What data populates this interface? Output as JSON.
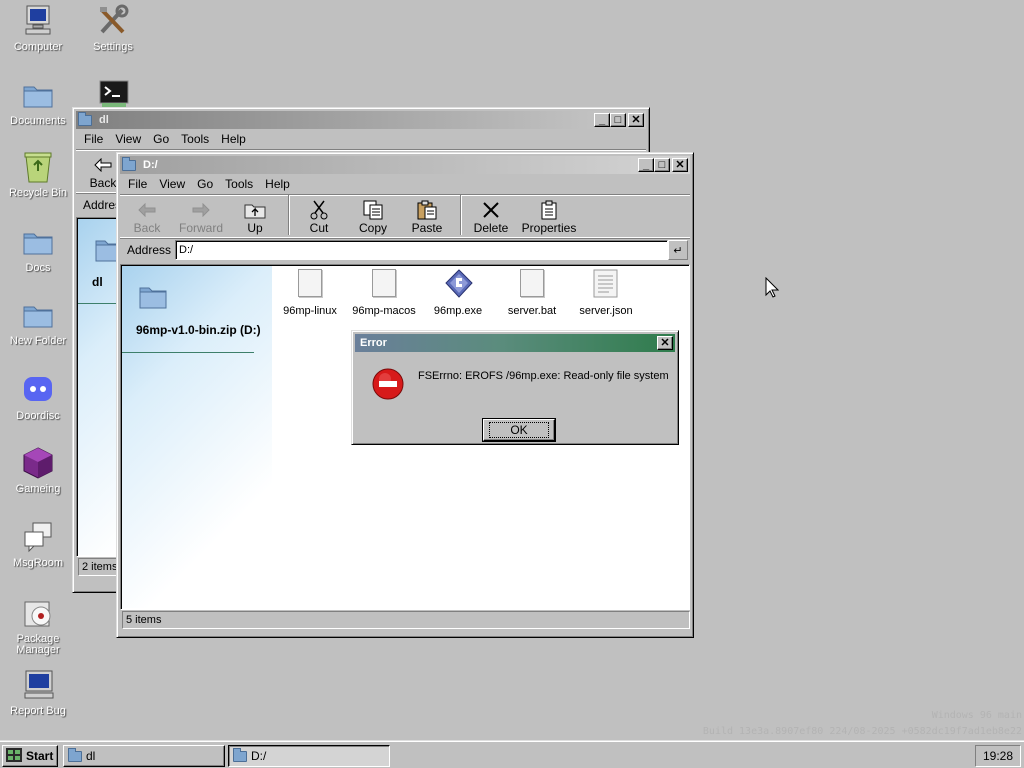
{
  "desktop": {
    "icons": [
      {
        "label": "Computer",
        "icon": "computer-icon"
      },
      {
        "label": "Settings",
        "icon": "settings-icon"
      },
      {
        "label": "Documents",
        "icon": "folder-icon"
      },
      {
        "label": "",
        "icon": "terminal-icon"
      },
      {
        "label": "Recycle Bin",
        "icon": "recycle-bin-icon"
      },
      {
        "label": "Docs",
        "icon": "folder-icon"
      },
      {
        "label": "New Folder",
        "icon": "folder-icon"
      },
      {
        "label": "Doordisc",
        "icon": "discord-icon"
      },
      {
        "label": "Gameing",
        "icon": "game-cube-icon"
      },
      {
        "label": "MsgRoom",
        "icon": "chat-icon"
      },
      {
        "label": "Package Manager",
        "icon": "package-icon"
      },
      {
        "label": "Report Bug",
        "icon": "bug-report-icon"
      }
    ],
    "watermark_line1": "Windows 96 main",
    "watermark_line2": "Build 13e3a.8907ef80 224/08-2025 +0582dc19f7ad1eb8e22"
  },
  "window_dl": {
    "title": "dl",
    "menu": [
      "File",
      "View",
      "Go",
      "Tools",
      "Help"
    ],
    "back_label": "Back",
    "address_label": "Addres",
    "panel_label": "dl",
    "status": "2 items"
  },
  "window_d": {
    "title": "D:/",
    "menu": [
      "File",
      "View",
      "Go",
      "Tools",
      "Help"
    ],
    "toolbar": {
      "back": "Back",
      "forward": "Forward",
      "up": "Up",
      "cut": "Cut",
      "copy": "Copy",
      "paste": "Paste",
      "delete": "Delete",
      "properties": "Properties"
    },
    "address_label": "Address",
    "address_value": "D:/",
    "panel_label": "96mp-v1.0-bin.zip (D:)",
    "files": [
      {
        "name": "96mp-linux",
        "type": "file"
      },
      {
        "name": "96mp-macos",
        "type": "file"
      },
      {
        "name": "96mp.exe",
        "type": "exe"
      },
      {
        "name": "server.bat",
        "type": "file"
      },
      {
        "name": "server.json",
        "type": "text"
      }
    ],
    "status": "5 items"
  },
  "error_dialog": {
    "title": "Error",
    "message": "FSErrno: EROFS /96mp.exe: Read-only file system",
    "ok_label": "OK"
  },
  "taskbar": {
    "start_label": "Start",
    "tasks": [
      {
        "label": "dl"
      },
      {
        "label": "D:/"
      }
    ],
    "clock": "19:28"
  }
}
